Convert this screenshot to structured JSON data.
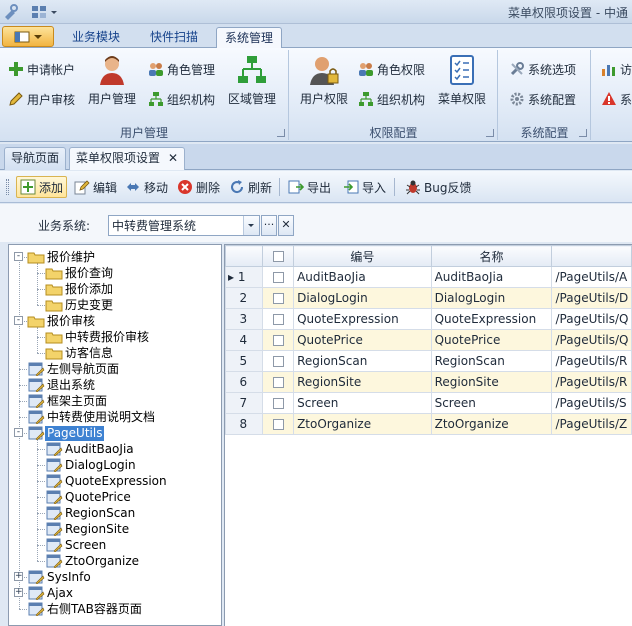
{
  "window": {
    "title": "菜单权限项设置 - 中通"
  },
  "ribbon": {
    "tabs": [
      "业务模块",
      "快件扫描",
      "系统管理"
    ],
    "active_tab": "系统管理",
    "groups": {
      "user_mgmt": {
        "label": "用户管理",
        "apply_account": "申请帐户",
        "user_audit": "用户审核",
        "user_manage": "用户管理",
        "role_manage": "角色管理",
        "org_a": "组织机构",
        "region_manage": "区域管理"
      },
      "perm_config": {
        "label": "权限配置",
        "user_perm": "用户权限",
        "role_perm": "角色权限",
        "org_b": "组织机构",
        "menu_perm": "菜单权限"
      },
      "sys_config": {
        "label": "系统配置",
        "sys_options": "系统选项",
        "sys_config": "系统配置"
      },
      "overflow": {
        "item1": "访",
        "item2": "系"
      }
    }
  },
  "doc_tabs": {
    "nav": "导航页面",
    "menu_perm": "菜单权限项设置",
    "close": "✕"
  },
  "toolbar": {
    "add": "添加",
    "edit": "编辑",
    "move": "移动",
    "delete": "删除",
    "refresh": "刷新",
    "export": "导出",
    "import": "导入",
    "bug": "Bug反馈"
  },
  "filter": {
    "label": "业务系统:",
    "value": "中转费管理系统",
    "ellipsis": "···",
    "clear": "✕"
  },
  "tree": {
    "nodes": [
      {
        "label": "报价维护",
        "level": 0,
        "type": "folder",
        "exp": "-"
      },
      {
        "label": "报价查询",
        "level": 1,
        "type": "folder"
      },
      {
        "label": "报价添加",
        "level": 1,
        "type": "folder"
      },
      {
        "label": "历史变更",
        "level": 1,
        "type": "folder"
      },
      {
        "label": "报价审核",
        "level": 0,
        "type": "folder",
        "exp": "-"
      },
      {
        "label": "中转费报价审核",
        "level": 1,
        "type": "folder"
      },
      {
        "label": "访客信息",
        "level": 1,
        "type": "folder"
      },
      {
        "label": "左侧导航页面",
        "level": 0,
        "type": "page"
      },
      {
        "label": "退出系统",
        "level": 0,
        "type": "page"
      },
      {
        "label": "框架主页面",
        "level": 0,
        "type": "page"
      },
      {
        "label": "中转费使用说明文档",
        "level": 0,
        "type": "page"
      },
      {
        "label": "PageUtils",
        "level": 0,
        "type": "page",
        "exp": "-",
        "selected": true
      },
      {
        "label": "AuditBaoJia",
        "level": 1,
        "type": "page"
      },
      {
        "label": "DialogLogin",
        "level": 1,
        "type": "page"
      },
      {
        "label": "QuoteExpression",
        "level": 1,
        "type": "page"
      },
      {
        "label": "QuotePrice",
        "level": 1,
        "type": "page"
      },
      {
        "label": "RegionScan",
        "level": 1,
        "type": "page"
      },
      {
        "label": "RegionSite",
        "level": 1,
        "type": "page"
      },
      {
        "label": "Screen",
        "level": 1,
        "type": "page"
      },
      {
        "label": "ZtoOrganize",
        "level": 1,
        "type": "page"
      },
      {
        "label": "SysInfo",
        "level": 0,
        "type": "page",
        "exp": "+"
      },
      {
        "label": "Ajax",
        "level": 0,
        "type": "page",
        "exp": "+"
      },
      {
        "label": "右侧TAB容器页面",
        "level": 0,
        "type": "page"
      }
    ]
  },
  "grid": {
    "columns": {
      "code": "编号",
      "name": "名称"
    },
    "current_marker": "▸",
    "rows": [
      {
        "n": "1",
        "code": "AuditBaoJia",
        "name": "AuditBaoJia",
        "path": "/PageUtils/A"
      },
      {
        "n": "2",
        "code": "DialogLogin",
        "name": "DialogLogin",
        "path": "/PageUtils/D"
      },
      {
        "n": "3",
        "code": "QuoteExpression",
        "name": "QuoteExpression",
        "path": "/PageUtils/Q"
      },
      {
        "n": "4",
        "code": "QuotePrice",
        "name": "QuotePrice",
        "path": "/PageUtils/Q"
      },
      {
        "n": "5",
        "code": "RegionScan",
        "name": "RegionScan",
        "path": "/PageUtils/R"
      },
      {
        "n": "6",
        "code": "RegionSite",
        "name": "RegionSite",
        "path": "/PageUtils/R"
      },
      {
        "n": "7",
        "code": "Screen",
        "name": "Screen",
        "path": "/PageUtils/S"
      },
      {
        "n": "8",
        "code": "ZtoOrganize",
        "name": "ZtoOrganize",
        "path": "/PageUtils/Z"
      }
    ]
  },
  "colors": {
    "selection": "#3e82d2",
    "alt_row": "#fdf7dd",
    "accent_orange": "#f2b441"
  }
}
